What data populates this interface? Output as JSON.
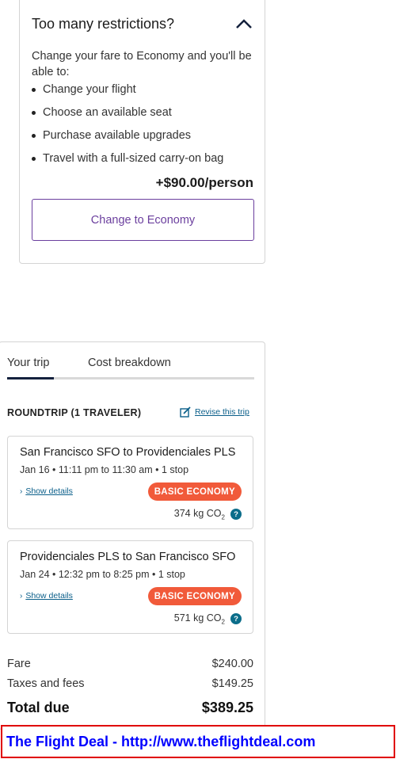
{
  "restrictions": {
    "title": "Too many restrictions?",
    "intro": "Change your fare to Economy and you'll be able to:",
    "benefits": [
      "Change your flight",
      "Choose an available seat",
      "Purchase available upgrades",
      "Travel with a full-sized carry-on bag"
    ],
    "price": "+$90.00/person",
    "button_label": "Change to Economy"
  },
  "trip": {
    "tabs": [
      "Your trip",
      "Cost breakdown"
    ],
    "roundtrip_label": "ROUNDTRIP (1 TRAVELER)",
    "revise_label": "Revise this trip",
    "flights": [
      {
        "route": "San Francisco SFO to Providenciales PLS",
        "times": "Jan 16 • 11:11 pm to 11:30 am • 1 stop",
        "details_label": "Show details",
        "fare_class": "BASIC ECONOMY",
        "co2_value": "374 kg CO",
        "co2_sub": "2"
      },
      {
        "route": "Providenciales PLS to San Francisco SFO",
        "times": "Jan 24 • 12:32 pm to 8:25 pm • 1 stop",
        "details_label": "Show details",
        "fare_class": "BASIC ECONOMY",
        "co2_value": "571 kg CO",
        "co2_sub": "2"
      }
    ],
    "costs": {
      "fare_label": "Fare",
      "fare_value": "$240.00",
      "taxes_label": "Taxes and fees",
      "taxes_value": "$149.25",
      "total_label": "Total due",
      "total_value": "$389.25"
    }
  },
  "watermark": "The Flight Deal - http://www.theflightdeal.com",
  "colors": {
    "accent_purple": "#6b3f9e",
    "badge_orange": "#f15a3a",
    "link_blue": "#0b5f8a",
    "tab_active": "#14213d"
  },
  "icons": [
    "chevron-up-icon",
    "edit-icon",
    "chevron-right-icon",
    "help-icon"
  ]
}
